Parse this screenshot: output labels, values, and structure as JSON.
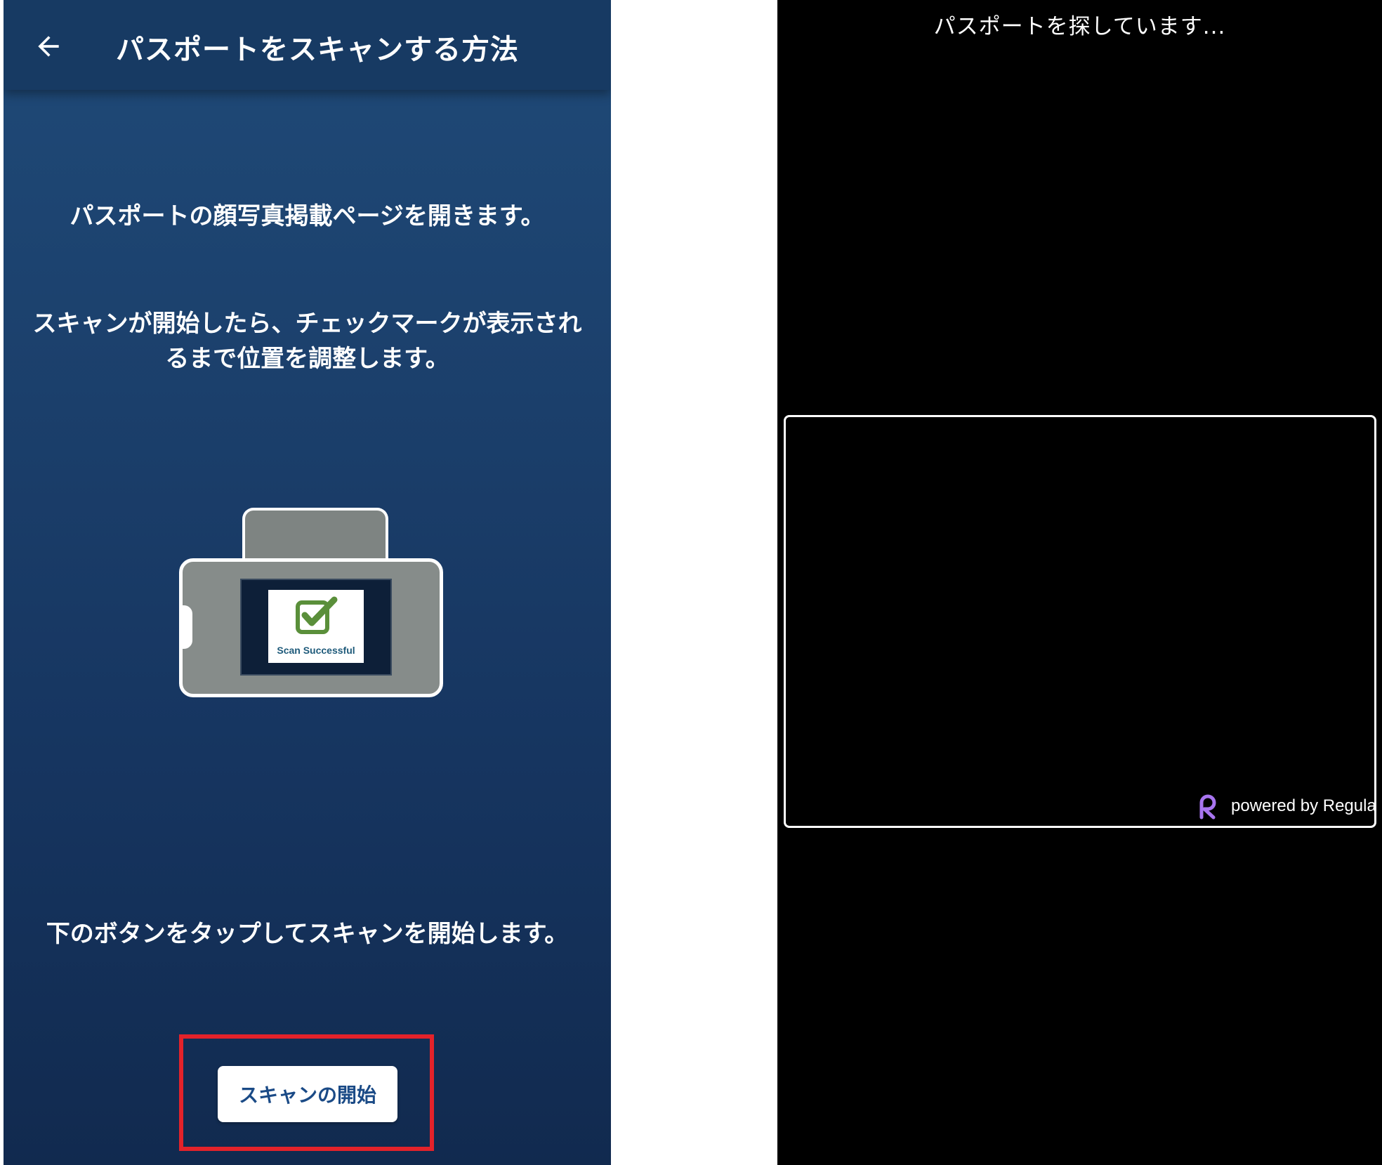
{
  "left_screen": {
    "header": {
      "back_icon": "arrow-left-icon",
      "title": "パスポートをスキャンする方法"
    },
    "instructions": [
      "パスポートの顔写真掲載ページを開きます。",
      "スキャンが開始したら、チェックマークが表示されるまで位置を調整します。",
      "下のボタンをタップしてスキャンを開始します。"
    ],
    "illustration": {
      "check_icon": "checkmark-icon",
      "scan_text": "Scan Successful"
    },
    "start_button_label": "スキャンの開始"
  },
  "right_screen": {
    "status_text": "パスポートを探しています...",
    "branding": {
      "logo_icon": "regula-logo-icon",
      "text": "powered by Regula"
    }
  },
  "colors": {
    "header_bg": "#173a63",
    "gradient_top": "#1f4a78",
    "gradient_bottom": "#112a4f",
    "button_text": "#1a4a86",
    "highlight_border": "#e3222a",
    "check_green": "#5a8f3a",
    "regula_purple": "#a875f0",
    "camera_bg": "#000000"
  }
}
